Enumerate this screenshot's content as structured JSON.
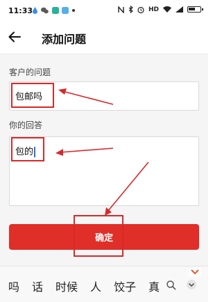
{
  "status_bar": {
    "time": "11:33",
    "hd_label": "HD",
    "app_icons": [
      "water-drop-icon",
      "wechat-icon",
      "app-icon",
      "app-icon",
      "dot-icon"
    ],
    "system_icons": [
      "nfc-icon",
      "bluetooth-icon",
      "alarm-icon",
      "hd-icon",
      "wifi-icon",
      "signal-icon",
      "battery-icon"
    ]
  },
  "header": {
    "title": "添加问题",
    "back_icon": "back-arrow-icon"
  },
  "form": {
    "question_label": "客户的问题",
    "question_value": "包邮吗",
    "answer_label": "你的回答",
    "answer_value": "包的"
  },
  "confirm_button": {
    "label": "确定",
    "color": "#e02e28"
  },
  "annotation_color": "#d7282a",
  "keyboard": {
    "suggestions": [
      "吗",
      "话",
      "时候",
      "人",
      "饺子",
      "真"
    ],
    "icons": [
      "search-icon",
      "chevron-down-icon"
    ]
  }
}
